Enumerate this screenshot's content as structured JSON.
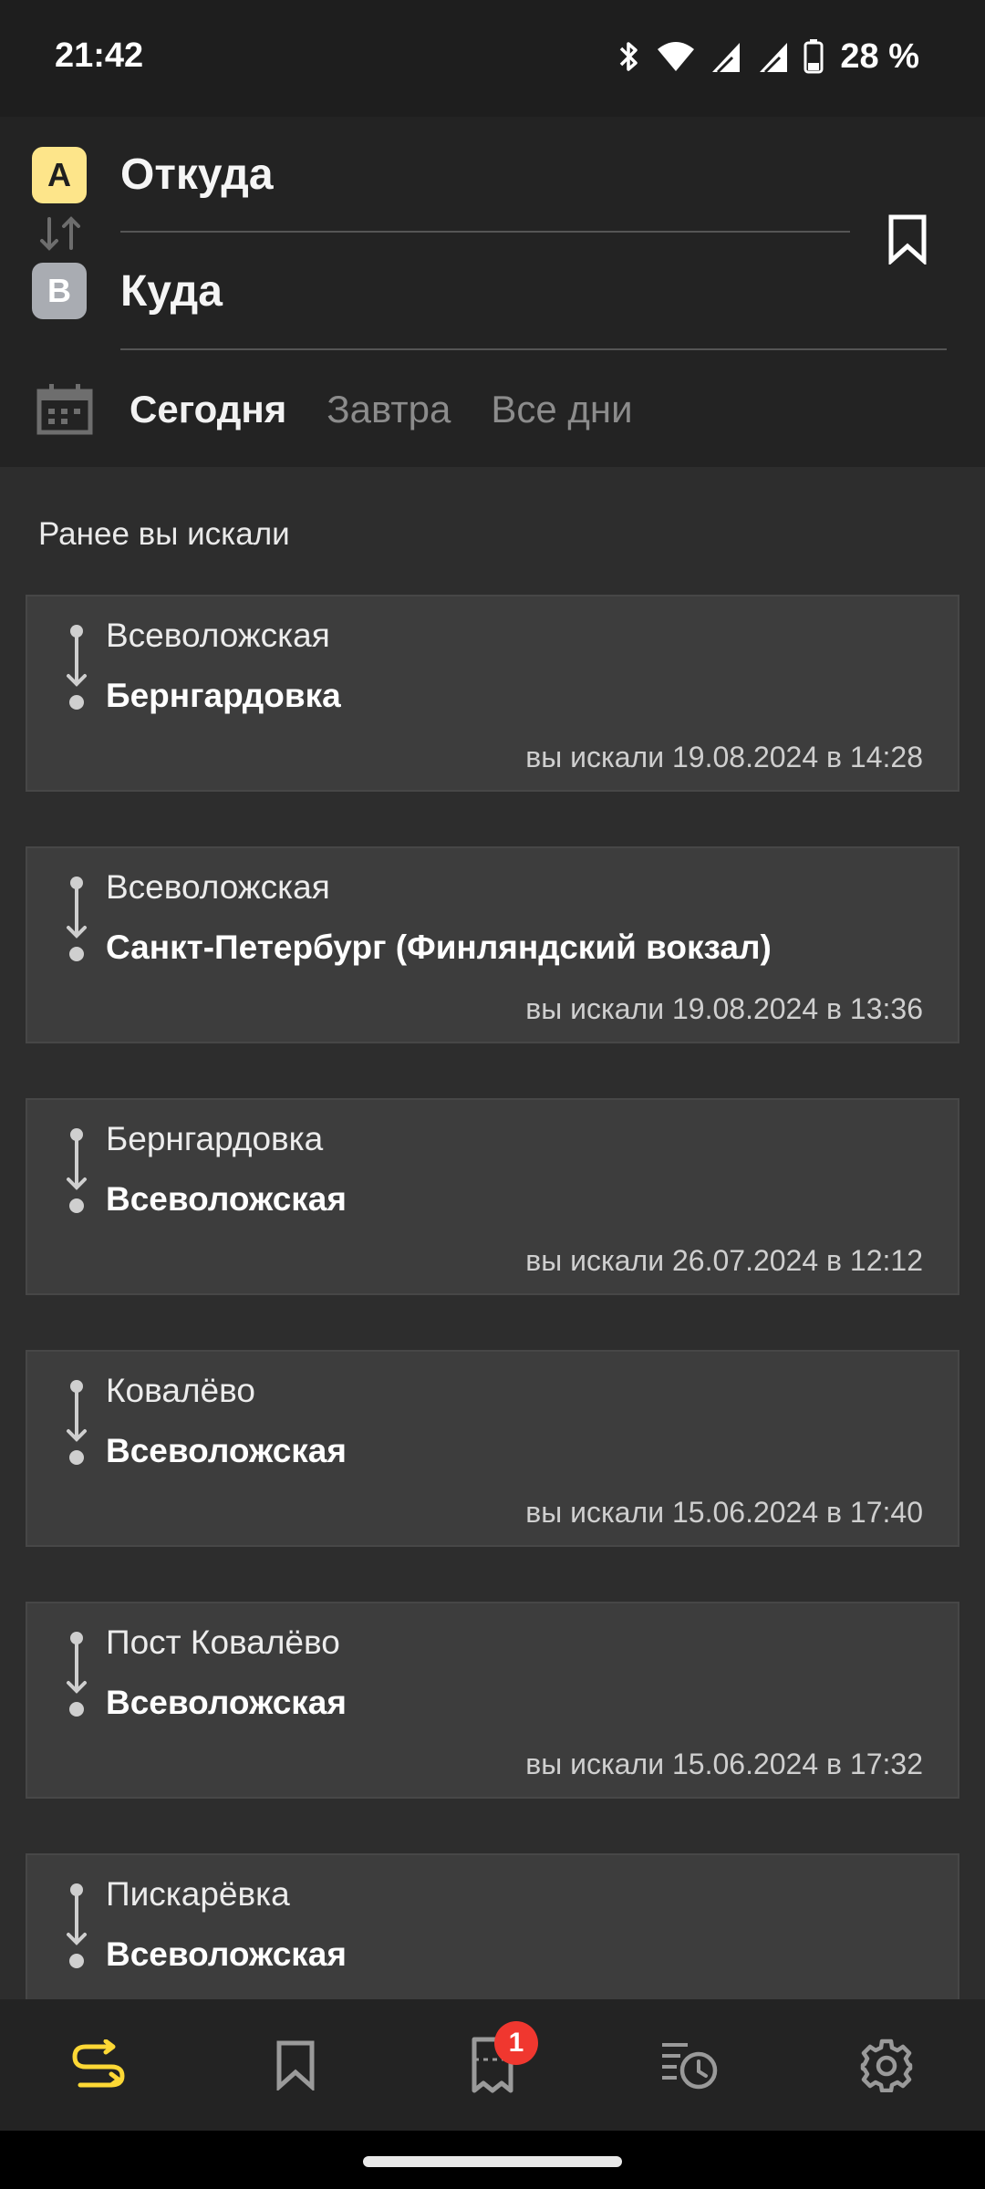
{
  "status_bar": {
    "time": "21:42",
    "battery": "28 %",
    "icons": [
      "bluetooth-icon",
      "wifi-icon",
      "signal-icon",
      "signal-icon",
      "battery-icon"
    ]
  },
  "route": {
    "from_badge": "A",
    "from_placeholder": "Откуда",
    "to_badge": "B",
    "to_placeholder": "Куда"
  },
  "dates": {
    "today": "Сегодня",
    "tomorrow": "Завтра",
    "all_days": "Все дни"
  },
  "history": {
    "title": "Ранее вы искали",
    "items": [
      {
        "from": "Всеволожская",
        "to": "Бернгардовка",
        "searched": "вы искали 19.08.2024 в 14:28"
      },
      {
        "from": "Всеволожская",
        "to": "Санкт-Петербург (Финляндский вокзал)",
        "searched": "вы искали 19.08.2024 в 13:36"
      },
      {
        "from": "Бернгардовка",
        "to": "Всеволожская",
        "searched": "вы искали 26.07.2024 в 12:12"
      },
      {
        "from": "Ковалёво",
        "to": "Всеволожская",
        "searched": "вы искали 15.06.2024 в 17:40"
      },
      {
        "from": "Пост Ковалёво",
        "to": "Всеволожская",
        "searched": "вы искали 15.06.2024 в 17:32"
      },
      {
        "from": "Пискарёвка",
        "to": "Всеволожская",
        "searched": ""
      }
    ]
  },
  "bottom_nav": {
    "tickets_badge": "1",
    "items": [
      "routes-icon",
      "bookmark-icon",
      "ticket-icon",
      "history-icon",
      "gear-icon"
    ]
  },
  "colors": {
    "accent": "#fdd835",
    "badge_a": "#fde58a",
    "badge_b": "#a9acb2",
    "notification": "#f0372f",
    "background": "#2d2d2d",
    "card": "#3d3d3d"
  }
}
